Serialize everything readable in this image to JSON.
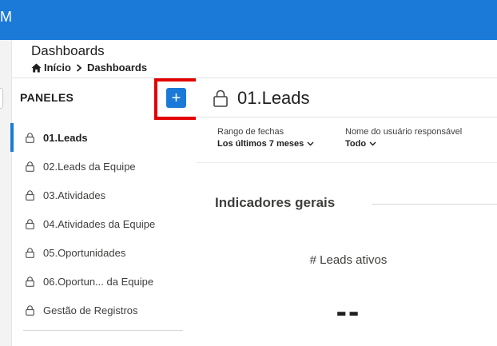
{
  "topbar": {
    "app_letter": "M",
    "color": "#1b7ad8"
  },
  "header": {
    "title": "Dashboards",
    "breadcrumb": {
      "home": "Início",
      "current": "Dashboards"
    }
  },
  "sidebar": {
    "title": "PANELES",
    "add_label": "+",
    "items": [
      {
        "label": "01.Leads",
        "active": true
      },
      {
        "label": "02.Leads da Equipe"
      },
      {
        "label": "03.Atividades"
      },
      {
        "label": "04.Atividades da Equipe"
      },
      {
        "label": "05.Oportunidades"
      },
      {
        "label": "06.Oportun... da Equipe"
      },
      {
        "label": "Gestão de Registros"
      }
    ]
  },
  "dashboard": {
    "title": "01.Leads",
    "filters": [
      {
        "label": "Rango de fechas",
        "value": "Los últimos 7 meses"
      },
      {
        "label": "Nome do usuário responsável",
        "value": "Todo"
      }
    ],
    "section_title": "Indicadores gerais",
    "metric": {
      "label": "# Leads ativos",
      "value": "--"
    }
  },
  "colors": {
    "accent": "#1b7ad8",
    "highlight": "#e30000"
  }
}
